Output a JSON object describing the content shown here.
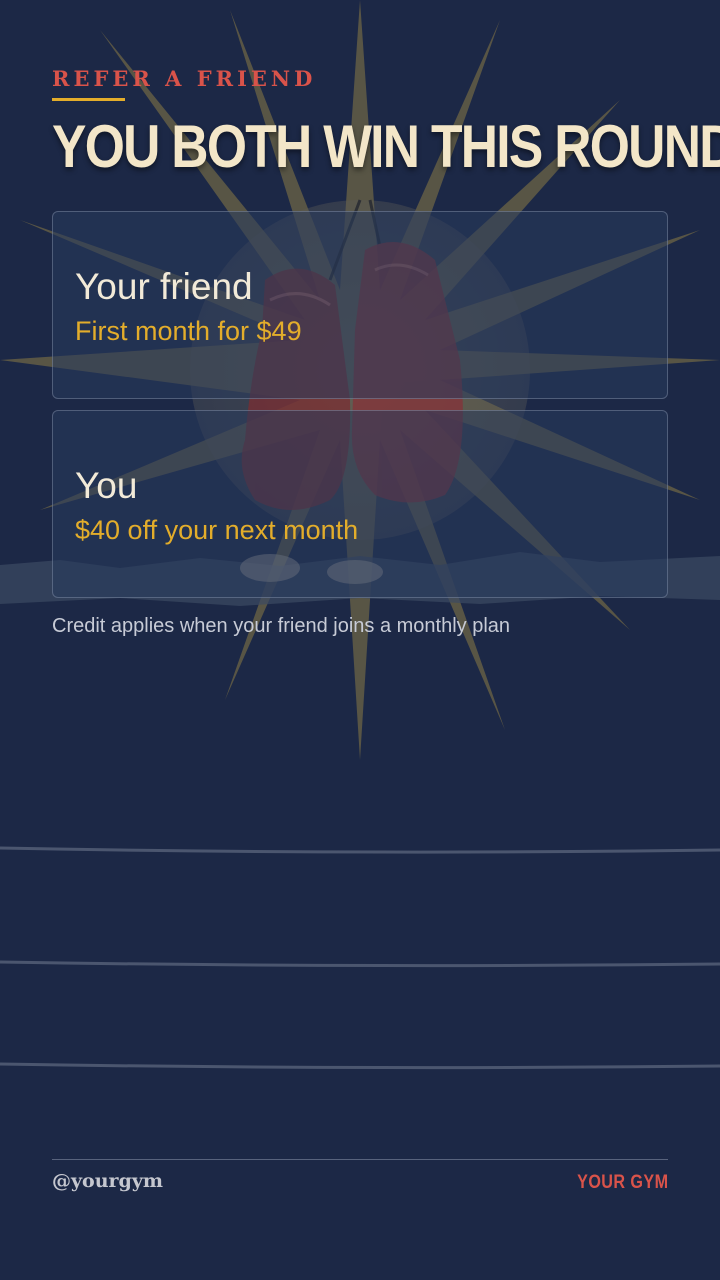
{
  "header": {
    "eyebrow": "REFER A FRIEND",
    "headline": "YOU BOTH WIN THIS ROUND"
  },
  "cards": [
    {
      "title": "Your friend",
      "subtitle": "First month for $49"
    },
    {
      "title": "You",
      "subtitle": "$40 off your next month"
    }
  ],
  "note": "Credit applies when your friend joins a monthly plan",
  "footer": {
    "handle": "@yourgym",
    "brand": "YOUR GYM"
  },
  "colors": {
    "background": "#1c2846",
    "accent_gold": "#e3ad2b",
    "accent_red": "#d9534a",
    "headline": "#f3e6c8"
  },
  "icons": [
    "starburst-graphic",
    "boxing-gloves-illustration",
    "ring-ropes-graphic"
  ]
}
